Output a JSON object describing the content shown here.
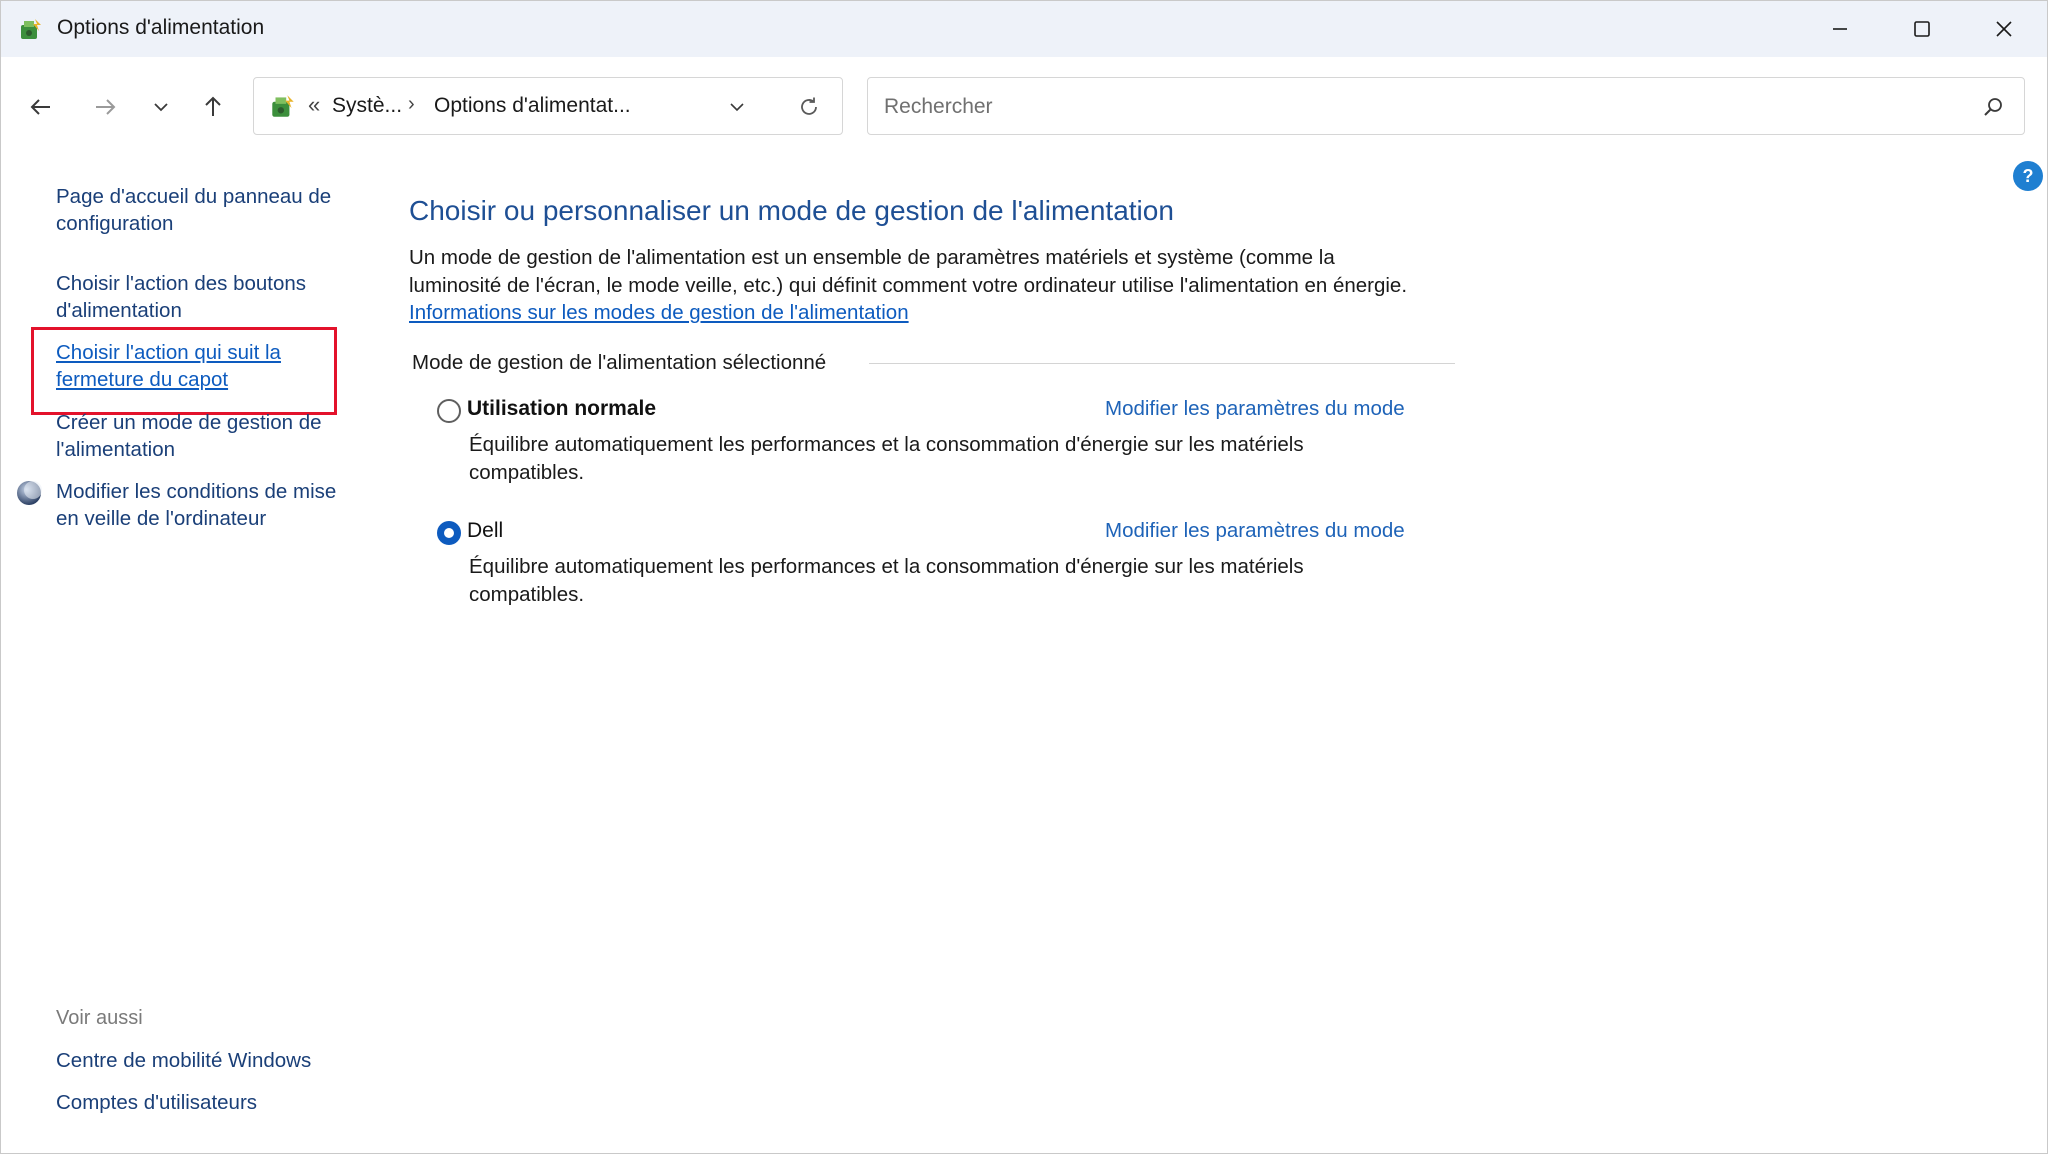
{
  "window": {
    "title": "Options d'alimentation",
    "controls": {
      "minimize": "minimize-icon",
      "maximize": "maximize-icon",
      "close": "close-icon"
    }
  },
  "nav": {
    "address": {
      "crumb_sep": "«",
      "crumbs": [
        "Systè...",
        "Options d'alimentat..."
      ],
      "separator": "›"
    },
    "search": {
      "placeholder": "Rechercher"
    }
  },
  "help": {
    "label": "?"
  },
  "left_pane": {
    "links": [
      {
        "label": "Page d'accueil du panneau de configuration"
      },
      {
        "label": "Choisir l'action des boutons d'alimentation"
      },
      {
        "label": "Choisir l'action qui suit la fermeture du capot"
      },
      {
        "label": "Créer un mode de gestion de l'alimentation"
      },
      {
        "label": "Modifier les conditions de mise en veille de l'ordinateur"
      }
    ],
    "see_also": {
      "heading": "Voir aussi",
      "links": [
        {
          "label": "Centre de mobilité Windows"
        },
        {
          "label": "Comptes d'utilisateurs"
        }
      ]
    }
  },
  "main": {
    "title": "Choisir ou personnaliser un mode de gestion de l'alimentation",
    "description": "Un mode de gestion de l'alimentation est un ensemble de paramètres matériels et système (comme la luminosité de l'écran, le mode veille, etc.) qui définit comment votre ordinateur utilise l'alimentation en énergie. ",
    "info_link": "Informations sur les modes de gestion de l'alimentation",
    "section_label": "Mode de gestion de l'alimentation sélectionné",
    "plans": [
      {
        "name": "Utilisation normale",
        "selected": false,
        "modify_label": "Modifier les paramètres du mode",
        "description": "Équilibre automatiquement les performances et la consommation d'énergie sur les matériels compatibles."
      },
      {
        "name": "Dell",
        "selected": true,
        "modify_label": "Modifier les paramètres du mode",
        "description": "Équilibre automatiquement les performances et la consommation d'énergie sur les matériels compatibles."
      }
    ]
  },
  "colors": {
    "accent": "#0d5bbf",
    "title_blue": "#1e4f94",
    "highlight": "#e3122b",
    "titlebar_bg": "#eef2f9"
  }
}
